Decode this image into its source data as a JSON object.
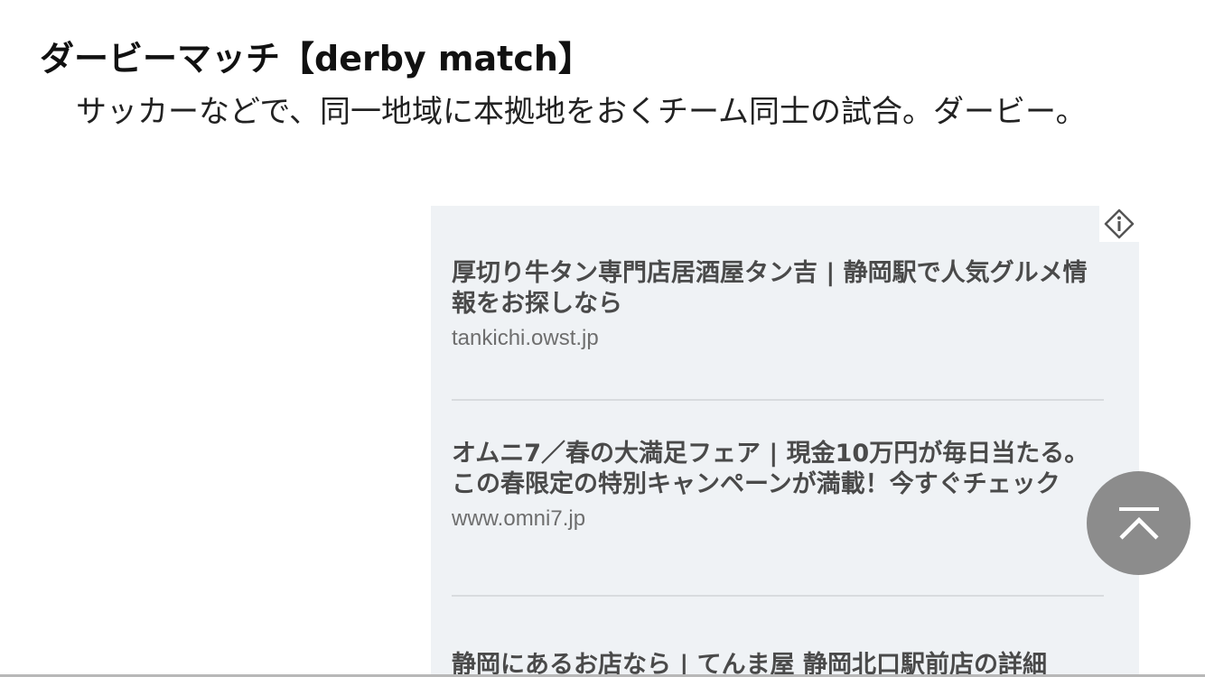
{
  "entry": {
    "title": "ダービーマッチ【derby match】",
    "definition": "サッカーなどで、同一地域に本拠地をおくチーム同士の試合。ダービー。"
  },
  "ads": [
    {
      "title": "厚切り牛タン専門店居酒屋タン吉 | 静岡駅で人気グルメ情報をお探しなら",
      "url": "tankichi.owst.jp"
    },
    {
      "title": "オムニ7／春の大満足フェア | 現金10万円が毎日当たる。この春限定の特別キャンペーンが満載！今すぐチェック",
      "url": "www.omni7.jp"
    },
    {
      "title": "静岡にあるお店なら | てんま屋 静岡北口駅前店の詳細",
      "url": ""
    }
  ],
  "icons": {
    "ad_info": "ad-info-icon",
    "scroll_top": "chevron-up-icon"
  },
  "colors": {
    "ad_background": "#eff2f5",
    "scroll_button": "#8c8c8c"
  }
}
